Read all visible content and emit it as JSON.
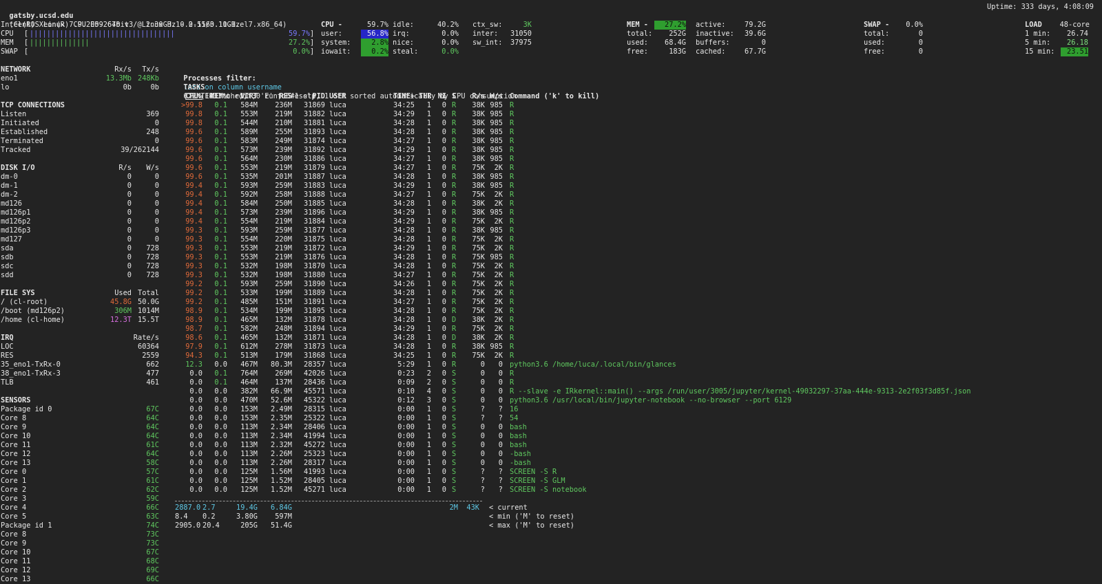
{
  "header": {
    "host": "gatsby.ucsd.edu",
    "os": "(CentOS Linux 7.9.2009 64bit / Linux 3.10.0-1160.11.1.el7.x86_64)",
    "uptime": "Uptime: 333 days, 4:08:09"
  },
  "quicklook": {
    "cpu_name": "Intel(R) Xeon(R) CPU E5-2670 v3 @ 2.30GHz - 2.55/3.10GHz",
    "bars": [
      {
        "label": "CPU",
        "bar": "||||||||||||||||||||||||||||||||||",
        "value": "59.7%",
        "fraction": 0.597,
        "color": "#7a7aff"
      },
      {
        "label": "MEM",
        "bar": "||||||||||||||",
        "value": "27.2%",
        "fraction": 0.272,
        "color": "#5fc85f"
      },
      {
        "label": "SWAP",
        "bar": "",
        "value": "0.0%",
        "fraction": 0.0,
        "color": "#5fc85f"
      }
    ]
  },
  "cpu": {
    "title": "CPU",
    "total": "59.7%",
    "col1": [
      [
        "user:",
        "56.8%"
      ],
      [
        "system:",
        "2.8%"
      ],
      [
        "iowait:",
        "0.2%"
      ]
    ],
    "col2": [
      [
        "idle:",
        "40.2%"
      ],
      [
        "irq:",
        "0.0%"
      ],
      [
        "nice:",
        "0.0%"
      ],
      [
        "steal:",
        "0.0%"
      ]
    ],
    "col3": [
      [
        "ctx_sw:",
        "3K"
      ],
      [
        "inter:",
        "31050"
      ],
      [
        "sw_int:",
        "37975"
      ]
    ]
  },
  "mem": {
    "title": "MEM",
    "total_pct": "27.2%",
    "col1": [
      [
        "total:",
        "252G"
      ],
      [
        "used:",
        "68.4G"
      ],
      [
        "free:",
        "183G"
      ]
    ],
    "col2": [
      [
        "active:",
        "79.2G"
      ],
      [
        "inactive:",
        "39.6G"
      ],
      [
        "buffers:",
        "0"
      ],
      [
        "cached:",
        "67.7G"
      ]
    ]
  },
  "swap": {
    "title": "SWAP",
    "total_pct": "0.0%",
    "rows": [
      [
        "total:",
        "0"
      ],
      [
        "used:",
        "0"
      ],
      [
        "free:",
        "0"
      ]
    ]
  },
  "load": {
    "title": "LOAD",
    "cores": "48-core",
    "rows": [
      [
        "1 min:",
        "26.74"
      ],
      [
        "5 min:",
        "26.18"
      ],
      [
        "15 min:",
        "23.51"
      ]
    ]
  },
  "network": {
    "title": "NETWORK",
    "rx": "Rx/s",
    "tx": "Tx/s",
    "rows": [
      [
        "eno1",
        "13.3Mb",
        "248Kb"
      ],
      [
        "lo",
        "0b",
        "0b"
      ]
    ]
  },
  "tcp": {
    "title": "TCP CONNECTIONS",
    "rows": [
      [
        "Listen",
        "369"
      ],
      [
        "Initiated",
        "0"
      ],
      [
        "Established",
        "248"
      ],
      [
        "Terminated",
        "0"
      ],
      [
        "Tracked",
        "39/262144"
      ]
    ]
  },
  "diskio": {
    "title": "DISK I/O",
    "r": "R/s",
    "w": "W/s",
    "rows": [
      [
        "dm-0",
        "0",
        "0"
      ],
      [
        "dm-1",
        "0",
        "0"
      ],
      [
        "dm-2",
        "0",
        "0"
      ],
      [
        "md126",
        "0",
        "0"
      ],
      [
        "md126p1",
        "0",
        "0"
      ],
      [
        "md126p2",
        "0",
        "0"
      ],
      [
        "md126p3",
        "0",
        "0"
      ],
      [
        "md127",
        "0",
        "0"
      ],
      [
        "sda",
        "0",
        "728"
      ],
      [
        "sdb",
        "0",
        "728"
      ],
      [
        "sdc",
        "0",
        "728"
      ],
      [
        "sdd",
        "0",
        "728"
      ]
    ]
  },
  "fs": {
    "title": "FILE SYS",
    "used": "Used",
    "total": "Total",
    "rows": [
      [
        "/ (cl-root)",
        "45.8G",
        "50.0G",
        "#e06a3a"
      ],
      [
        "/boot (md126p2)",
        "306M",
        "1014M",
        "#5fc85f"
      ],
      [
        "/home (cl-home)",
        "12.3T",
        "15.5T",
        "#d870e0"
      ]
    ]
  },
  "irq": {
    "title": "IRQ",
    "rate": "Rate/s",
    "rows": [
      [
        "LOC",
        "60364"
      ],
      [
        "RES",
        "2559"
      ],
      [
        "35_eno1-TxRx-0",
        "662"
      ],
      [
        "38_eno1-TxRx-3",
        "477"
      ],
      [
        "TLB",
        "461"
      ]
    ]
  },
  "sensors": {
    "title": "SENSORS",
    "rows": [
      [
        "Package id 0",
        "67C"
      ],
      [
        "Core 8",
        "64C"
      ],
      [
        "Core 9",
        "64C"
      ],
      [
        "Core 10",
        "64C"
      ],
      [
        "Core 11",
        "61C"
      ],
      [
        "Core 12",
        "64C"
      ],
      [
        "Core 13",
        "58C"
      ],
      [
        "Core 0",
        "57C"
      ],
      [
        "Core 1",
        "61C"
      ],
      [
        "Core 2",
        "62C"
      ],
      [
        "Core 3",
        "59C"
      ],
      [
        "Core 4",
        "66C"
      ],
      [
        "Core 5",
        "63C"
      ],
      [
        "Package id 1",
        "74C"
      ],
      [
        "Core 8",
        "73C"
      ],
      [
        "Core 9",
        "73C"
      ],
      [
        "Core 10",
        "67C"
      ],
      [
        "Core 11",
        "68C"
      ],
      [
        "Core 12",
        "69C"
      ],
      [
        "Core 13",
        "66C"
      ]
    ]
  },
  "processes": {
    "filter_label": "Processes filter:",
    "filter_value": "luca on column username",
    "filter_hint": "('ENTER' to edit, 'E' to reset)",
    "tasks_label": "TASKS",
    "tasks_text": "672 (1433 thr), 30 run, 641 slp, 1 oth sorted automatically by CPU consumption",
    "headers": [
      "CPU%",
      "MEM%",
      "VIRT",
      "RES",
      "PID",
      "USER",
      "TIME+",
      "THR",
      "NI",
      "S",
      "R/s",
      "W/s",
      "Command ('k' to kill)"
    ],
    "rows": [
      [
        ">99.8",
        "0.1",
        "584M",
        "236M",
        "31869",
        "luca",
        "34:25",
        "1",
        "0",
        "R",
        "38K",
        "985",
        "R"
      ],
      [
        "99.8",
        "0.1",
        "553M",
        "219M",
        "31882",
        "luca",
        "34:29",
        "1",
        "0",
        "R",
        "38K",
        "985",
        "R"
      ],
      [
        "99.8",
        "0.1",
        "544M",
        "210M",
        "31881",
        "luca",
        "34:28",
        "1",
        "0",
        "R",
        "38K",
        "985",
        "R"
      ],
      [
        "99.6",
        "0.1",
        "589M",
        "255M",
        "31893",
        "luca",
        "34:28",
        "1",
        "0",
        "R",
        "38K",
        "985",
        "R"
      ],
      [
        "99.6",
        "0.1",
        "583M",
        "249M",
        "31874",
        "luca",
        "34:27",
        "1",
        "0",
        "R",
        "38K",
        "985",
        "R"
      ],
      [
        "99.6",
        "0.1",
        "573M",
        "239M",
        "31892",
        "luca",
        "34:29",
        "1",
        "0",
        "R",
        "38K",
        "985",
        "R"
      ],
      [
        "99.6",
        "0.1",
        "564M",
        "230M",
        "31886",
        "luca",
        "34:27",
        "1",
        "0",
        "R",
        "38K",
        "985",
        "R"
      ],
      [
        "99.6",
        "0.1",
        "553M",
        "219M",
        "31879",
        "luca",
        "34:27",
        "1",
        "0",
        "R",
        "75K",
        "2K",
        "R"
      ],
      [
        "99.6",
        "0.1",
        "535M",
        "201M",
        "31887",
        "luca",
        "34:28",
        "1",
        "0",
        "R",
        "38K",
        "985",
        "R"
      ],
      [
        "99.4",
        "0.1",
        "593M",
        "259M",
        "31883",
        "luca",
        "34:29",
        "1",
        "0",
        "R",
        "38K",
        "985",
        "R"
      ],
      [
        "99.4",
        "0.1",
        "592M",
        "258M",
        "31888",
        "luca",
        "34:27",
        "1",
        "0",
        "R",
        "75K",
        "2K",
        "R"
      ],
      [
        "99.4",
        "0.1",
        "584M",
        "250M",
        "31885",
        "luca",
        "34:28",
        "1",
        "0",
        "R",
        "38K",
        "2K",
        "R"
      ],
      [
        "99.4",
        "0.1",
        "573M",
        "239M",
        "31896",
        "luca",
        "34:29",
        "1",
        "0",
        "R",
        "38K",
        "985",
        "R"
      ],
      [
        "99.4",
        "0.1",
        "554M",
        "219M",
        "31884",
        "luca",
        "34:29",
        "1",
        "0",
        "R",
        "75K",
        "2K",
        "R"
      ],
      [
        "99.3",
        "0.1",
        "593M",
        "259M",
        "31877",
        "luca",
        "34:28",
        "1",
        "0",
        "R",
        "38K",
        "985",
        "R"
      ],
      [
        "99.3",
        "0.1",
        "554M",
        "220M",
        "31875",
        "luca",
        "34:28",
        "1",
        "0",
        "R",
        "75K",
        "2K",
        "R"
      ],
      [
        "99.3",
        "0.1",
        "553M",
        "219M",
        "31872",
        "luca",
        "34:29",
        "1",
        "0",
        "R",
        "75K",
        "2K",
        "R"
      ],
      [
        "99.3",
        "0.1",
        "553M",
        "219M",
        "31876",
        "luca",
        "34:28",
        "1",
        "0",
        "R",
        "75K",
        "985",
        "R"
      ],
      [
        "99.3",
        "0.1",
        "532M",
        "198M",
        "31870",
        "luca",
        "34:28",
        "1",
        "0",
        "R",
        "75K",
        "2K",
        "R"
      ],
      [
        "99.3",
        "0.1",
        "532M",
        "198M",
        "31880",
        "luca",
        "34:27",
        "1",
        "0",
        "R",
        "75K",
        "2K",
        "R"
      ],
      [
        "99.2",
        "0.1",
        "593M",
        "259M",
        "31890",
        "luca",
        "34:26",
        "1",
        "0",
        "R",
        "75K",
        "2K",
        "R"
      ],
      [
        "99.2",
        "0.1",
        "533M",
        "199M",
        "31889",
        "luca",
        "34:28",
        "1",
        "0",
        "R",
        "75K",
        "2K",
        "R"
      ],
      [
        "99.2",
        "0.1",
        "485M",
        "151M",
        "31891",
        "luca",
        "34:27",
        "1",
        "0",
        "R",
        "75K",
        "2K",
        "R"
      ],
      [
        "98.9",
        "0.1",
        "534M",
        "199M",
        "31895",
        "luca",
        "34:28",
        "1",
        "0",
        "R",
        "75K",
        "2K",
        "R"
      ],
      [
        "98.9",
        "0.1",
        "465M",
        "132M",
        "31878",
        "luca",
        "34:28",
        "1",
        "0",
        "D",
        "38K",
        "2K",
        "R"
      ],
      [
        "98.7",
        "0.1",
        "582M",
        "248M",
        "31894",
        "luca",
        "34:29",
        "1",
        "0",
        "R",
        "75K",
        "2K",
        "R"
      ],
      [
        "98.6",
        "0.1",
        "465M",
        "132M",
        "31871",
        "luca",
        "34:28",
        "1",
        "0",
        "D",
        "38K",
        "2K",
        "R"
      ],
      [
        "97.9",
        "0.1",
        "612M",
        "278M",
        "31873",
        "luca",
        "34:28",
        "1",
        "0",
        "R",
        "38K",
        "985",
        "R"
      ],
      [
        "94.3",
        "0.1",
        "513M",
        "179M",
        "31868",
        "luca",
        "34:25",
        "1",
        "0",
        "R",
        "75K",
        "2K",
        "R"
      ],
      [
        "12.3",
        "0.0",
        "467M",
        "80.3M",
        "28357",
        "luca",
        "5:29",
        "1",
        "0",
        "R",
        "0",
        "0",
        "python3.6 /home/luca/.local/bin/glances"
      ],
      [
        "0.0",
        "0.1",
        "764M",
        "269M",
        "42026",
        "luca",
        "0:23",
        "2",
        "0",
        "S",
        "0",
        "0",
        "R"
      ],
      [
        "0.0",
        "0.1",
        "464M",
        "137M",
        "28436",
        "luca",
        "0:09",
        "2",
        "0",
        "S",
        "0",
        "0",
        "R"
      ],
      [
        "0.0",
        "0.0",
        "382M",
        "66.9M",
        "45571",
        "luca",
        "0:10",
        "4",
        "0",
        "S",
        "0",
        "0",
        "R --slave -e IRkernel::main() --args /run/user/3005/jupyter/kernel-49032297-37aa-444e-9313-2e2f03f3d85f.json"
      ],
      [
        "0.0",
        "0.0",
        "470M",
        "52.6M",
        "45322",
        "luca",
        "0:12",
        "3",
        "0",
        "S",
        "0",
        "0",
        "python3.6 /usr/local/bin/jupyter-notebook --no-browser --port 6129"
      ],
      [
        "0.0",
        "0.0",
        "153M",
        "2.49M",
        "28315",
        "luca",
        "0:00",
        "1",
        "0",
        "S",
        "?",
        "?",
        "16"
      ],
      [
        "0.0",
        "0.0",
        "153M",
        "2.35M",
        "25322",
        "luca",
        "0:00",
        "1",
        "0",
        "S",
        "?",
        "?",
        "54"
      ],
      [
        "0.0",
        "0.0",
        "113M",
        "2.34M",
        "28406",
        "luca",
        "0:00",
        "1",
        "0",
        "S",
        "0",
        "0",
        "bash"
      ],
      [
        "0.0",
        "0.0",
        "113M",
        "2.34M",
        "41994",
        "luca",
        "0:00",
        "1",
        "0",
        "S",
        "0",
        "0",
        "bash"
      ],
      [
        "0.0",
        "0.0",
        "113M",
        "2.32M",
        "45272",
        "luca",
        "0:00",
        "1",
        "0",
        "S",
        "0",
        "0",
        "bash"
      ],
      [
        "0.0",
        "0.0",
        "113M",
        "2.26M",
        "25323",
        "luca",
        "0:00",
        "1",
        "0",
        "S",
        "0",
        "0",
        "-bash"
      ],
      [
        "0.0",
        "0.0",
        "113M",
        "2.26M",
        "28317",
        "luca",
        "0:00",
        "1",
        "0",
        "S",
        "0",
        "0",
        "-bash"
      ],
      [
        "0.0",
        "0.0",
        "125M",
        "1.56M",
        "41993",
        "luca",
        "0:00",
        "1",
        "0",
        "S",
        "?",
        "?",
        "SCREEN -S R"
      ],
      [
        "0.0",
        "0.0",
        "125M",
        "1.52M",
        "28405",
        "luca",
        "0:00",
        "1",
        "0",
        "S",
        "?",
        "?",
        "SCREEN -S GLM"
      ],
      [
        "0.0",
        "0.0",
        "125M",
        "1.52M",
        "45271",
        "luca",
        "0:00",
        "1",
        "0",
        "S",
        "?",
        "?",
        "SCREEN -S notebook"
      ]
    ],
    "summary": [
      {
        "cpu": "2887.0",
        "mem": "2.7",
        "virt": "19.4G",
        "res": "6.84G",
        "rw": "2M  43K",
        "note": "< current"
      },
      {
        "cpu": "8.4",
        "mem": "0.2",
        "virt": "3.80G",
        "res": "597M",
        "rw": "",
        "note": "< min ('M' to reset)"
      },
      {
        "cpu": "2905.0",
        "mem": "20.4",
        "virt": "205G",
        "res": "51.4G",
        "rw": "",
        "note": "< max ('M' to reset)"
      }
    ]
  }
}
